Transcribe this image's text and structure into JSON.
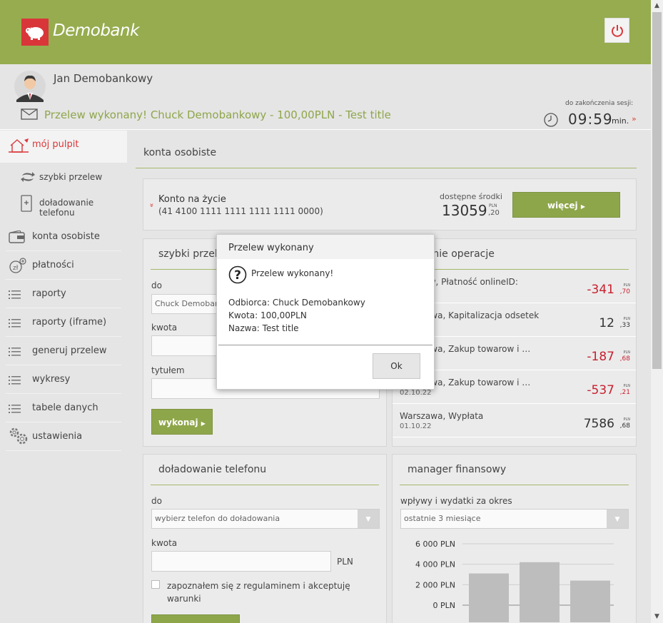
{
  "header": {
    "logo_text": "Demobank",
    "colors": {
      "brand": "#96ac4f",
      "logo_bg": "#d9363a",
      "negative": "#c8202f"
    }
  },
  "user": {
    "name": "Jan Demobankowy",
    "message": "Przelew wykonany! Chuck Demobankowy - 100,00PLN - Test title",
    "session_label": "do zakończenia sesji:",
    "session_time": "09:59",
    "session_unit": "min.",
    "session_link": "»"
  },
  "sidebar": {
    "items": [
      {
        "label": "mój pulpit",
        "icon": "home-icon"
      },
      {
        "label": "szybki przelew",
        "icon": "transfer-icon"
      },
      {
        "label": "doładowanie telefonu",
        "icon": "phone-icon"
      },
      {
        "label": "konta osobiste",
        "icon": "wallet-icon"
      },
      {
        "label": "płatności",
        "icon": "payments-icon"
      },
      {
        "label": "raporty",
        "icon": "list-icon"
      },
      {
        "label": "raporty (iframe)",
        "icon": "list-icon"
      },
      {
        "label": "generuj przelew",
        "icon": "list-icon"
      },
      {
        "label": "wykresy",
        "icon": "list-icon"
      },
      {
        "label": "tabele danych",
        "icon": "list-icon"
      },
      {
        "label": "ustawienia",
        "icon": "gear-icon"
      }
    ]
  },
  "main": {
    "title": "konta osobiste",
    "account": {
      "arrow": "»",
      "name": "Konto na życie",
      "number": "(41 4100 1111 1111 1111 1111 0000)",
      "available_label": "dostępne środki",
      "balance": "13059",
      "currency": "PLN",
      "decimals": ",20",
      "more_button": "więcej"
    },
    "quick_transfer": {
      "title": "szybki przelew",
      "to_label": "do",
      "to_value": "Chuck Demobankowy",
      "amount_label": "kwota",
      "title_label": "tytułem",
      "submit": "wykonaj"
    },
    "operations": {
      "title": "ostatnie operacje",
      "rows": [
        {
          "desc": "Wrocław, Płatność onlineID:",
          "date": "",
          "amount": "-341",
          "currency": "PLN",
          "decimals": ",70",
          "negative": true
        },
        {
          "desc": "Warszawa, Kapitalizacja odsetek",
          "date": "",
          "amount": "12",
          "currency": "PLN",
          "decimals": ",33",
          "negative": false
        },
        {
          "desc": "Warszawa, Zakup towarow i …",
          "date": "",
          "amount": "-187",
          "currency": "PLN",
          "decimals": ",68",
          "negative": true
        },
        {
          "desc": "Warszawa, Zakup towarow i …",
          "date": "02.10.22",
          "amount": "-537",
          "currency": "PLN",
          "decimals": ",21",
          "negative": true
        },
        {
          "desc": "Warszawa, Wypłata",
          "date": "01.10.22",
          "amount": "7586",
          "currency": "PLN",
          "decimals": ",68",
          "negative": false
        }
      ]
    },
    "phone_topup": {
      "title": "doładowanie telefonu",
      "to_label": "do",
      "to_placeholder": "wybierz telefon do doładowania",
      "amount_label": "kwota",
      "amount_unit": "PLN",
      "terms": "zapoznałem się z regulaminem i akceptuję warunki"
    },
    "finance_manager": {
      "title": "manager finansowy",
      "period_label": "wpływy i wydatki za okres",
      "period_value": "ostatnie 3 miesiące"
    }
  },
  "chart_data": {
    "type": "bar",
    "categories": [
      "",
      "",
      ""
    ],
    "values": [
      3100,
      4200,
      2400
    ],
    "ticks": [
      "6 000 PLN",
      "4 000 PLN",
      "2 000 PLN",
      "0 PLN"
    ],
    "ylim": [
      0,
      6000
    ]
  },
  "modal": {
    "title": "Przelew wykonany",
    "heading": "Przelew wykonany!",
    "recipient": "Odbiorca: Chuck Demobankowy",
    "amount": "Kwota: 100,00PLN",
    "name": "Nazwa: Test title",
    "ok": "Ok"
  }
}
